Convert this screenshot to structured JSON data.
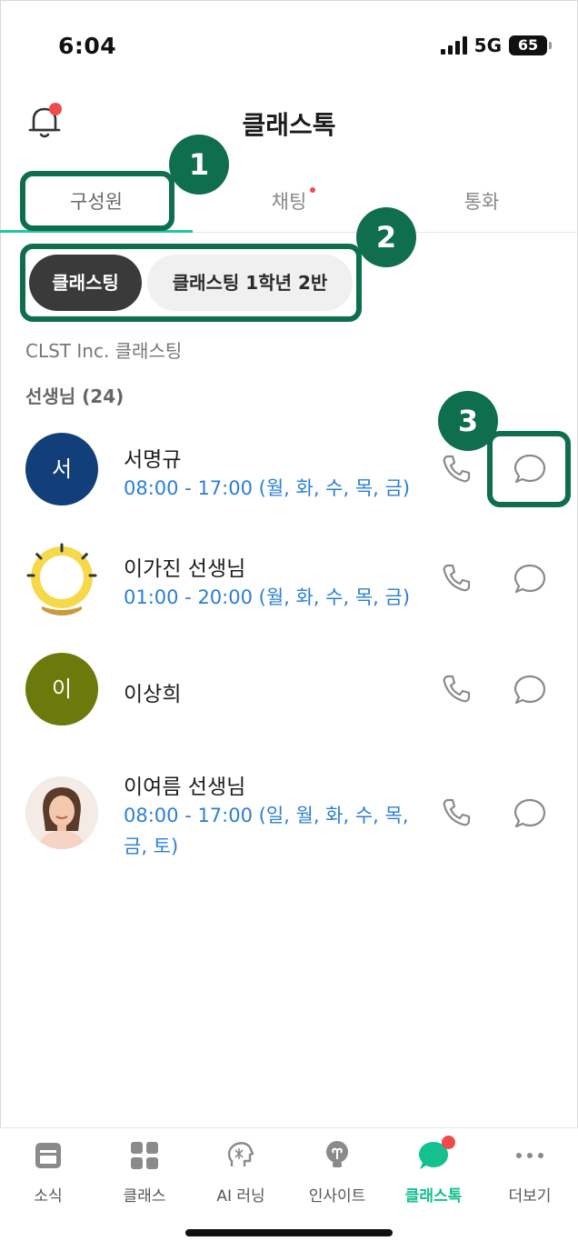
{
  "status_bar": {
    "time": "6:04",
    "network": "5G",
    "battery": "65"
  },
  "header": {
    "title": "클래스톡"
  },
  "tabs": [
    {
      "label": "구성원"
    },
    {
      "label": "채팅"
    },
    {
      "label": "통화"
    }
  ],
  "annotations": [
    "1",
    "2",
    "3"
  ],
  "chips": [
    {
      "label": "클래스팅"
    },
    {
      "label": "클래스팅 1학년 2반"
    }
  ],
  "organization": "CLST Inc. 클래스팅",
  "section_title": "선생님 (24)",
  "contacts": [
    {
      "name": "서명규",
      "initial": "서",
      "avatar_color": "#123f7a",
      "hours": "08:00 - 17:00 (월, 화, 수, 목, 금)",
      "hours2": ""
    },
    {
      "name": "이가진 선생님",
      "initial": "",
      "avatar_color": "#f2d84a",
      "hours": "01:00 - 20:00 (월, 화, 수, 목, 금)",
      "hours2": ""
    },
    {
      "name": "이상희",
      "initial": "이",
      "avatar_color": "#6b7a0a",
      "hours": "",
      "hours2": ""
    },
    {
      "name": "이여름 선생님",
      "initial": "",
      "avatar_color": "#f4e7df",
      "hours": "08:00 - 17:00 (일, 월, 화, 수, 목,",
      "hours2": "금, 토)"
    }
  ],
  "bottom_nav": [
    {
      "label": "소식",
      "icon": "news-icon"
    },
    {
      "label": "클래스",
      "icon": "class-grid-icon"
    },
    {
      "label": "AI 러닝",
      "icon": "ai-learning-icon"
    },
    {
      "label": "인사이트",
      "icon": "insight-bulb-icon"
    },
    {
      "label": "클래스톡",
      "icon": "classtalk-chat-icon"
    },
    {
      "label": "더보기",
      "icon": "more-dots-icon"
    }
  ],
  "colors": {
    "accent": "#14c08e",
    "annotation": "#0f6e4d",
    "link_blue": "#2b7fd4",
    "badge_red": "#f04a4a"
  }
}
